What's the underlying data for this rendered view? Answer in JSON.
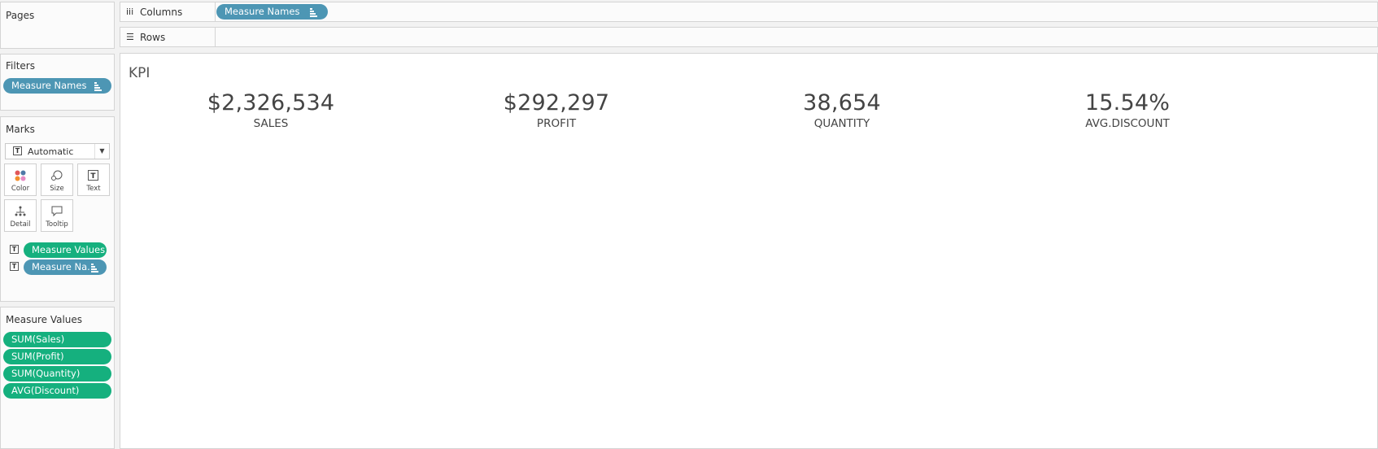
{
  "pages": {
    "title": "Pages"
  },
  "columns": {
    "label": "Columns",
    "pill": "Measure Names"
  },
  "rows": {
    "label": "Rows"
  },
  "filters": {
    "title": "Filters",
    "pill": "Measure Names"
  },
  "marks": {
    "title": "Marks",
    "type": "Automatic",
    "buttons": {
      "color": "Color",
      "size": "Size",
      "text": "Text",
      "detail": "Detail",
      "tooltip": "Tooltip"
    },
    "cards": [
      {
        "label": "Measure Values",
        "color": "green"
      },
      {
        "label": "Measure Na..",
        "color": "blue"
      }
    ]
  },
  "measure_values": {
    "title": "Measure Values",
    "items": [
      "SUM(Sales)",
      "SUM(Profit)",
      "SUM(Quantity)",
      "AVG(Discount)"
    ]
  },
  "view": {
    "title": "KPI",
    "kpis": [
      {
        "value": "$2,326,534",
        "label": "SALES"
      },
      {
        "value": "$292,297",
        "label": "PROFIT"
      },
      {
        "value": "38,654",
        "label": "QUANTITY"
      },
      {
        "value": "15.54%",
        "label": "AVG.DISCOUNT"
      }
    ]
  },
  "colors": {
    "blue_pill": "#4d96b4",
    "green_pill": "#15b07e"
  }
}
